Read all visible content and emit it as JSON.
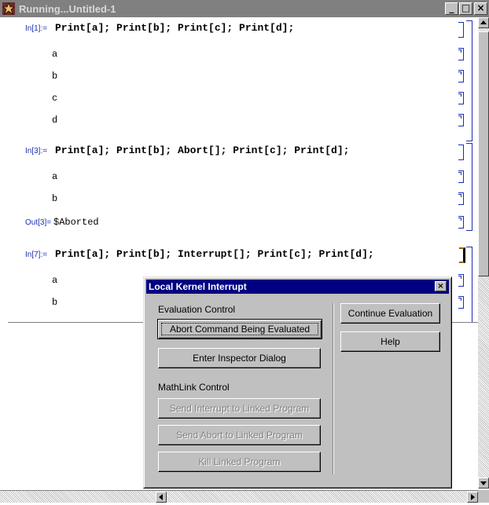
{
  "window": {
    "title": "Running...Untitled-1",
    "minimize_glyph": "_",
    "maximize_glyph": "□",
    "close_glyph": "×"
  },
  "notebook": {
    "cells": [
      {
        "kind": "input",
        "label": "In[1]:=",
        "code": "Print[a]; Print[b]; Print[c]; Print[d];"
      },
      {
        "kind": "print",
        "text": "a"
      },
      {
        "kind": "print",
        "text": "b"
      },
      {
        "kind": "print",
        "text": "c"
      },
      {
        "kind": "print",
        "text": "d"
      },
      {
        "kind": "input",
        "label": "In[3]:=",
        "code": "Print[a]; Print[b]; Abort[]; Print[c]; Print[d];"
      },
      {
        "kind": "print",
        "text": "a"
      },
      {
        "kind": "print",
        "text": "b"
      },
      {
        "kind": "output",
        "label": "Out[3]=",
        "text": "$Aborted"
      },
      {
        "kind": "input",
        "label": "In[7]:=",
        "code": "Print[a]; Print[b]; Interrupt[]; Print[c]; Print[d];"
      },
      {
        "kind": "print",
        "text": "a"
      },
      {
        "kind": "print",
        "text": "b"
      }
    ]
  },
  "dialog": {
    "title": "Local Kernel Interrupt",
    "close_glyph": "×",
    "evaluation_control_label": "Evaluation Control",
    "abort_command_label": "Abort Command Being Evaluated",
    "enter_inspector_label": "Enter Inspector Dialog",
    "mathlink_control_label": "MathLink Control",
    "send_interrupt_label": "Send Interrupt to Linked Program",
    "send_abort_label": "Send Abort to Linked Program",
    "kill_linked_label": "Kill Linked Program",
    "continue_label": "Continue Evaluation",
    "help_label": "Help"
  },
  "colors": {
    "cell_bracket": "#1a2fb5",
    "title_bar_inactive": "#808080",
    "dialog_title_bar": "#000080",
    "dialog_face": "#c0c0c0"
  }
}
